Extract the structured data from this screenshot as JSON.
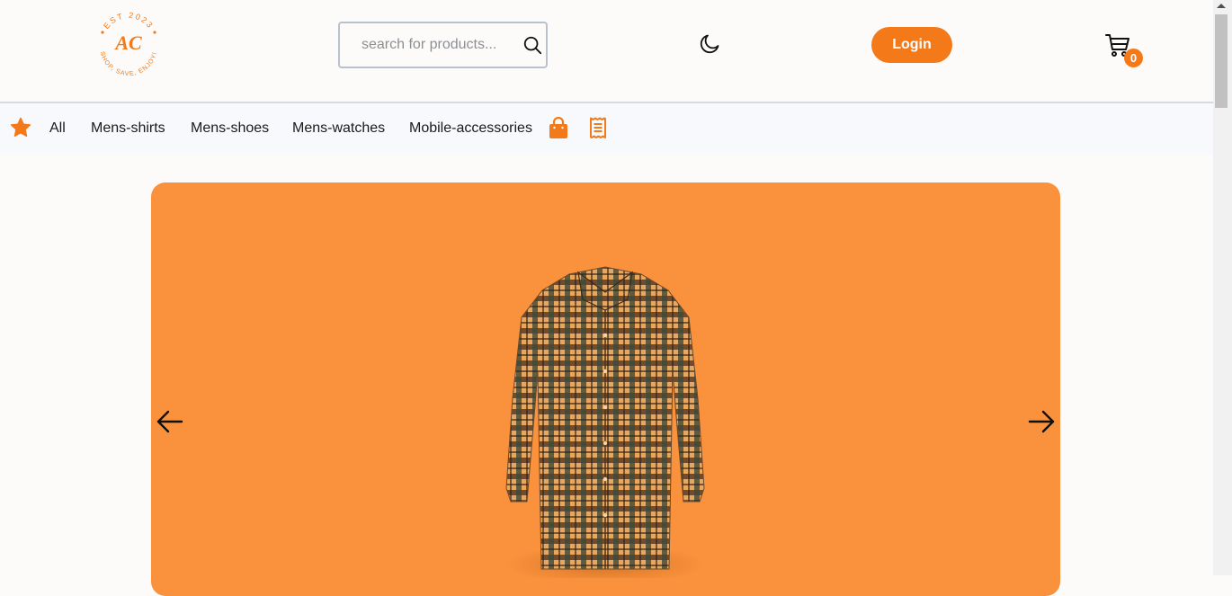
{
  "header": {
    "logo": {
      "monogram": "AC",
      "top_text": "EST 2023",
      "bottom_text": "SHOP, SAVE, ENJOY!",
      "color": "#f47a19"
    },
    "search": {
      "placeholder": "search for products...",
      "value": ""
    },
    "theme_toggle_icon": "moon-icon",
    "login_label": "Login",
    "cart_icon": "cart-icon",
    "cart_count": "0"
  },
  "categories": {
    "items": [
      "All",
      "Mens-shirts",
      "Mens-shoes",
      "Mens-watches",
      "Mobile-accessories"
    ],
    "icons": [
      "star-icon",
      "shopping-bag-icon",
      "receipt-icon"
    ]
  },
  "hero": {
    "background_color": "#fa913c",
    "image": "plaid-shirt",
    "prev_icon": "arrow-left-icon",
    "next_icon": "arrow-right-icon"
  },
  "colors": {
    "accent": "#f47a19",
    "hero": "#fa913c"
  }
}
